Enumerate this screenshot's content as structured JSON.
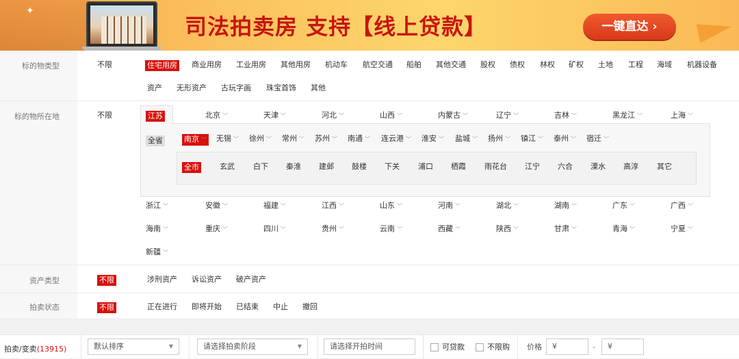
{
  "banner": {
    "title": "司法拍卖房  支持【线上贷款】",
    "cta": "一键直达 ›"
  },
  "filters": {
    "type": {
      "label": "标的物类型",
      "unlimited": "不限",
      "options": [
        "住宅用房",
        "商业用房",
        "工业用房",
        "其他用房",
        "机动车",
        "航空交通",
        "船舶",
        "其他交通",
        "股权",
        "债权",
        "林权",
        "矿权",
        "土地",
        "工程",
        "海域",
        "机器设备"
      ],
      "options2": [
        "资产",
        "无形资产",
        "古玩字画",
        "珠宝首饰",
        "其他"
      ],
      "selected": "住宅用房"
    },
    "location": {
      "label": "标的物所在地",
      "unlimited": "不限",
      "provinces_row1": [
        "江苏",
        "北京",
        "天津",
        "河北",
        "山西",
        "内蒙古",
        "辽宁",
        "吉林",
        "黑龙江",
        "上海"
      ],
      "selected_province": "江苏",
      "whole_province": "全省",
      "cities": [
        "南京",
        "无锡",
        "徐州",
        "常州",
        "苏州",
        "南通",
        "连云港",
        "淮安",
        "盐城",
        "扬州",
        "镇江",
        "泰州",
        "宿迁"
      ],
      "selected_city": "南京",
      "whole_city": "全市",
      "districts": [
        "玄武",
        "白下",
        "秦淮",
        "建邺",
        "鼓楼",
        "下关",
        "浦口",
        "栖霞",
        "雨花台",
        "江宁",
        "六合",
        "溧水",
        "高淳",
        "其它"
      ],
      "provinces_row2": [
        "浙江",
        "安徽",
        "福建",
        "江西",
        "山东",
        "河南",
        "湖北",
        "湖南",
        "广东",
        "广西"
      ],
      "provinces_row3": [
        "海南",
        "重庆",
        "四川",
        "贵州",
        "云南",
        "西藏",
        "陕西",
        "甘肃",
        "青海",
        "宁夏"
      ],
      "provinces_row4": [
        "新疆"
      ]
    },
    "asset": {
      "label": "资产类型",
      "unlimited": "不限",
      "options": [
        "涉刑资产",
        "诉讼资产",
        "破产资产"
      ]
    },
    "status": {
      "label": "拍卖状态",
      "unlimited": "不限",
      "options": [
        "正在进行",
        "即将开始",
        "已结束",
        "中止",
        "撤回"
      ]
    }
  },
  "toolbar": {
    "count_label": "拍卖/变卖",
    "count": "(13915)",
    "sort": "默认排序",
    "stage_placeholder": "请选择拍卖阶段",
    "time_placeholder": "请选择开拍时间",
    "loanable": "可贷款",
    "no_limit_purchase": "不限购",
    "price_label": "价格",
    "price_min": "¥",
    "price_dash": "-",
    "price_max": "¥"
  }
}
